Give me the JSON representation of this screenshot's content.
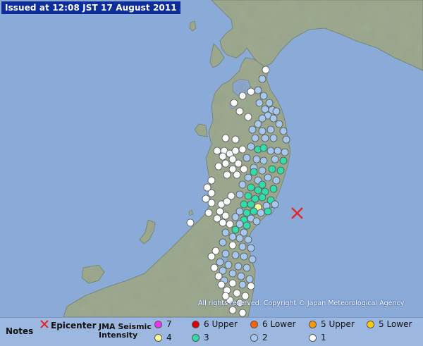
{
  "issued": "Issued at 12:08 JST  17 August 2011",
  "copyright": "All rights reserved. Copyright © Japan Meteorological Agency",
  "legend": {
    "notes": "Notes",
    "epicenter": "Epicenter",
    "scale_title_line1": "JMA Seismic",
    "scale_title_line2": "Intensity",
    "items": [
      {
        "label": "7",
        "color": "#ee33ee"
      },
      {
        "label": "6 Upper",
        "color": "#dd0000"
      },
      {
        "label": "6 Lower",
        "color": "#ff6600"
      },
      {
        "label": "5 Upper",
        "color": "#ff9900"
      },
      {
        "label": "5 Lower",
        "color": "#ffcc00"
      },
      {
        "label": "4",
        "color": "#ffff99"
      },
      {
        "label": "3",
        "color": "#33ddaa"
      },
      {
        "label": "2",
        "color": "#a6c8ef"
      },
      {
        "label": "1",
        "color": "#ffffff"
      }
    ]
  },
  "colors": {
    "sea": "#8aaad8",
    "land": "#9eab90",
    "epicenter_mark": "#e0262a",
    "issued_bg": "#0d2d9b"
  },
  "epicenter": {
    "label": "epicenter-mark"
  }
}
